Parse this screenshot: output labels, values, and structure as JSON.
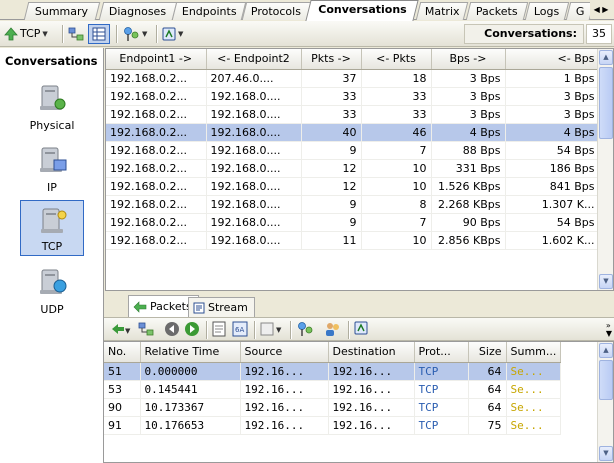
{
  "tabs": [
    {
      "label": "Summary",
      "active": false
    },
    {
      "label": "Diagnoses",
      "active": false
    },
    {
      "label": "Endpoints",
      "active": false
    },
    {
      "label": "Protocols",
      "active": false
    },
    {
      "label": "Conversations",
      "active": true
    },
    {
      "label": "Matrix",
      "active": false
    },
    {
      "label": "Packets",
      "active": false
    },
    {
      "label": "Logs",
      "active": false
    },
    {
      "label": "G",
      "active": false
    }
  ],
  "toolbar": {
    "protocol_label": "TCP",
    "conversations_label": "Conversations:",
    "conversations_count": "35"
  },
  "left_panel": {
    "title": "Conversations",
    "items": [
      {
        "label": "Physical"
      },
      {
        "label": "IP"
      },
      {
        "label": "TCP",
        "selected": true
      },
      {
        "label": "UDP"
      }
    ]
  },
  "conversations_table": {
    "columns": [
      "Endpoint1 ->",
      "<- Endpoint2",
      "Pkts ->",
      "<- Pkts",
      "Bps ->",
      "<- Bps"
    ],
    "rows": [
      [
        "192.168.0.2...",
        "207.46.0....",
        "37",
        "18",
        "3 Bps",
        "1 Bps"
      ],
      [
        "192.168.0.2...",
        "192.168.0....",
        "33",
        "33",
        "3 Bps",
        "3 Bps"
      ],
      [
        "192.168.0.2...",
        "192.168.0....",
        "33",
        "33",
        "3 Bps",
        "3 Bps"
      ],
      [
        "192.168.0.2...",
        "192.168.0....",
        "40",
        "46",
        "4 Bps",
        "4 Bps"
      ],
      [
        "192.168.0.2...",
        "192.168.0....",
        "9",
        "7",
        "88 Bps",
        "54 Bps"
      ],
      [
        "192.168.0.2...",
        "192.168.0....",
        "12",
        "10",
        "331 Bps",
        "186 Bps"
      ],
      [
        "192.168.0.2...",
        "192.168.0....",
        "12",
        "10",
        "1.526 KBps",
        "841 Bps"
      ],
      [
        "192.168.0.2...",
        "192.168.0....",
        "9",
        "8",
        "2.268 KBps",
        "1.307 K..."
      ],
      [
        "192.168.0.2...",
        "192.168.0....",
        "9",
        "7",
        "90 Bps",
        "54 Bps"
      ],
      [
        "192.168.0.2...",
        "192.168.0....",
        "11",
        "10",
        "2.856 KBps",
        "1.602 K..."
      ]
    ],
    "selected_row": 3
  },
  "lower_tabs": [
    {
      "label": "Packets",
      "active": true
    },
    {
      "label": "Stream",
      "active": false
    }
  ],
  "packets_table": {
    "columns": [
      "No.",
      "Relative Time",
      "Source",
      "Destination",
      "Prot...",
      "Size",
      "Summ..."
    ],
    "rows": [
      [
        "51",
        "0.000000",
        "192.16...",
        "192.16...",
        "TCP",
        "64",
        "Se..."
      ],
      [
        "53",
        "0.145441",
        "192.16...",
        "192.16...",
        "TCP",
        "64",
        "Se..."
      ],
      [
        "90",
        "10.173367",
        "192.16...",
        "192.16...",
        "TCP",
        "64",
        "Se..."
      ],
      [
        "91",
        "10.176653",
        "192.16...",
        "192.16...",
        "TCP",
        "75",
        "Se..."
      ]
    ],
    "selected_row": 0
  },
  "colors": {
    "selection": "#b7c8ea",
    "protocol_text": "#2a5db0",
    "summary_text": "#c7a600"
  }
}
